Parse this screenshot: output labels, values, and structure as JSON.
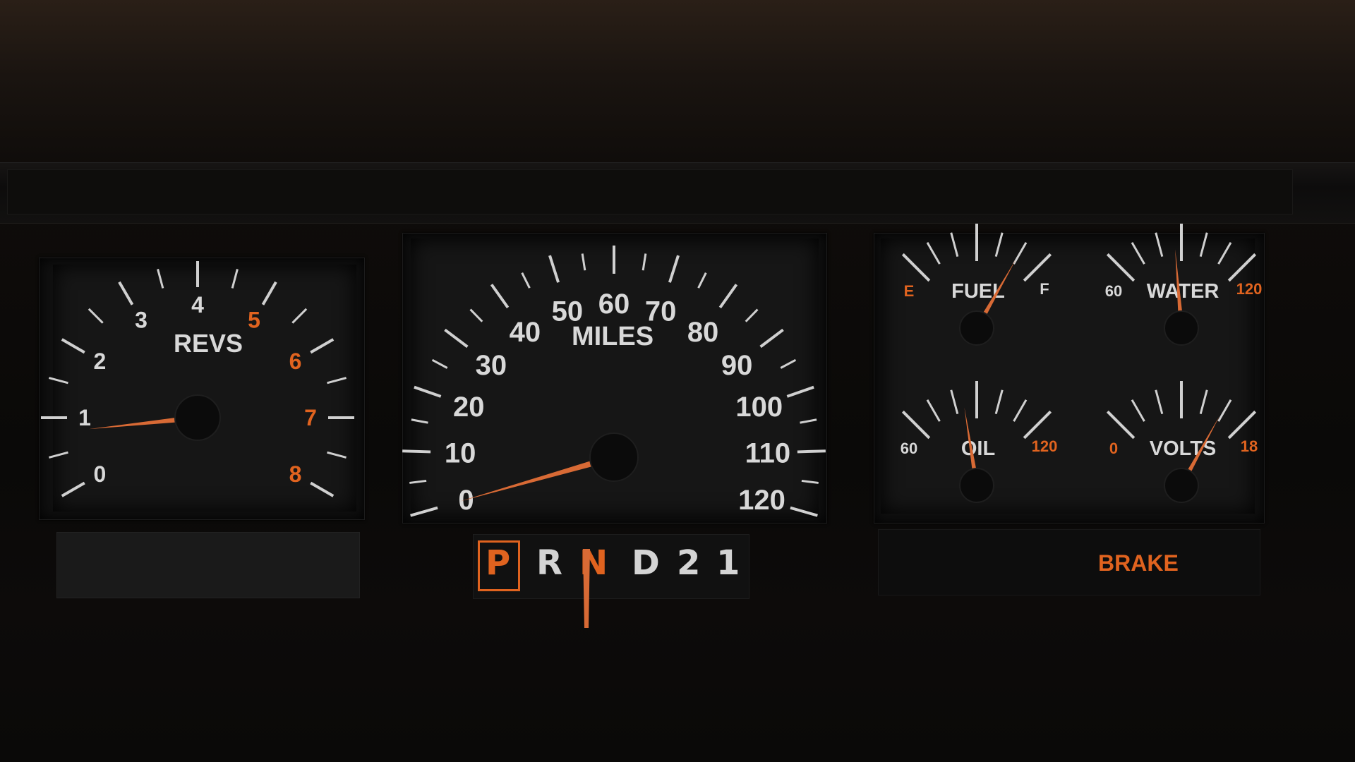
{
  "colors": {
    "accent": "#e0631f",
    "needle": "#d86a35",
    "label": "#d8d8d8",
    "face": "#161616"
  },
  "tachometer": {
    "title": "REVS",
    "ticks": [
      "0",
      "1",
      "2",
      "3",
      "4",
      "5",
      "6",
      "7",
      "8"
    ],
    "redline_start": "5",
    "value": 0.8
  },
  "speedometer": {
    "title": "MILES",
    "ticks": [
      "0",
      "10",
      "20",
      "30",
      "40",
      "50",
      "60",
      "70",
      "80",
      "90",
      "100",
      "110",
      "120"
    ],
    "value": 0
  },
  "fuel_gauge": {
    "title": "FUEL",
    "min_label": "E",
    "max_label": "F",
    "level": 0.83
  },
  "water_gauge": {
    "title": "WATER",
    "min_label": "60",
    "max_label": "120",
    "level": 0.45
  },
  "oil_gauge": {
    "title": "OIL",
    "min_label": "60",
    "max_label": "120",
    "level": 0.4
  },
  "volts_gauge": {
    "title": "VOLTS",
    "min_label": "0",
    "max_label": "18",
    "level": 0.82
  },
  "gear_selector": {
    "positions": [
      "P",
      "R",
      "N",
      "D",
      "2",
      "1"
    ],
    "selected": "P",
    "pointer_at": "N"
  },
  "warning": {
    "brake_label": "BRAKE"
  }
}
